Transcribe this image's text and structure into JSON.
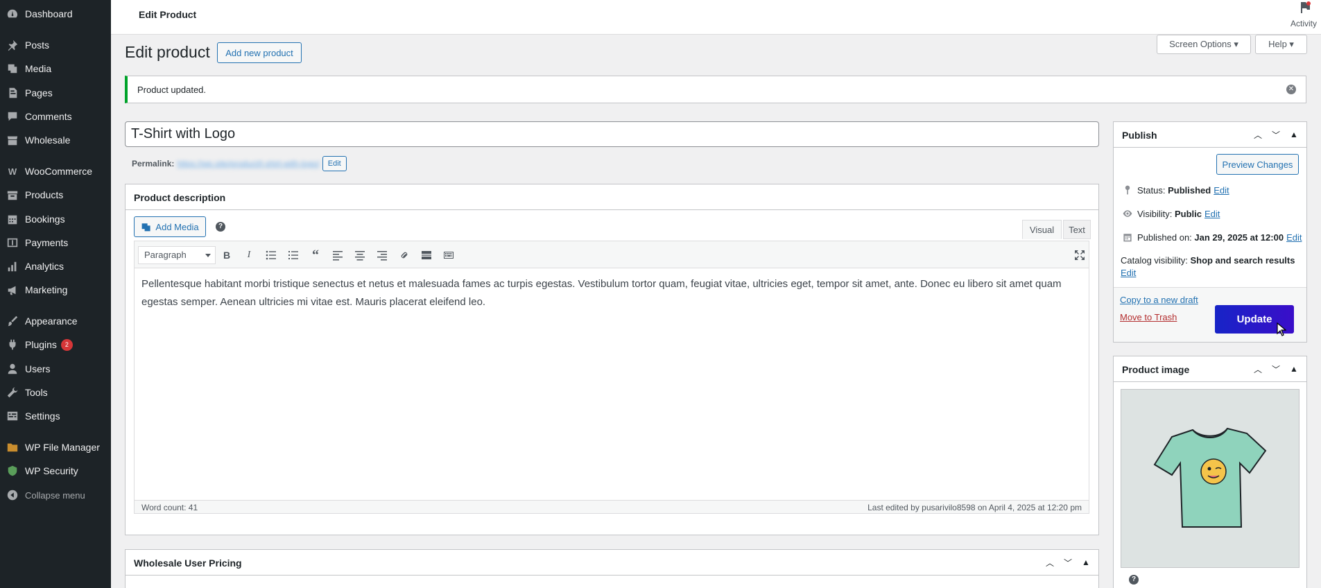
{
  "sidebar": {
    "items": [
      {
        "label": "Dashboard",
        "icon": "dashboard-icon"
      },
      {
        "label": "Posts",
        "icon": "pin-icon"
      },
      {
        "label": "Media",
        "icon": "media-icon"
      },
      {
        "label": "Pages",
        "icon": "pages-icon"
      },
      {
        "label": "Comments",
        "icon": "comment-icon"
      },
      {
        "label": "Wholesale",
        "icon": "store-icon"
      },
      {
        "label": "WooCommerce",
        "icon": "woo-icon"
      },
      {
        "label": "Products",
        "icon": "archive-icon"
      },
      {
        "label": "Bookings",
        "icon": "calendar-icon"
      },
      {
        "label": "Payments",
        "icon": "dollar-icon"
      },
      {
        "label": "Analytics",
        "icon": "chart-icon"
      },
      {
        "label": "Marketing",
        "icon": "megaphone-icon"
      },
      {
        "label": "Appearance",
        "icon": "brush-icon"
      },
      {
        "label": "Plugins",
        "icon": "plugin-icon",
        "badge": "2"
      },
      {
        "label": "Users",
        "icon": "user-icon"
      },
      {
        "label": "Tools",
        "icon": "wrench-icon"
      },
      {
        "label": "Settings",
        "icon": "settings-icon"
      },
      {
        "label": "WP File Manager",
        "icon": "folder-icon"
      },
      {
        "label": "WP Security",
        "icon": "shield-icon"
      }
    ],
    "collapse_label": "Collapse menu"
  },
  "topbar": {
    "page_label": "Edit Product",
    "activity_label": "Activity"
  },
  "header": {
    "title": "Edit product",
    "add_new_label": "Add new product",
    "screen_options_label": "Screen Options ▾",
    "help_label": "Help ▾"
  },
  "notice": {
    "text": "Product updated."
  },
  "product": {
    "title": "T-Shirt with Logo",
    "permalink_label": "Permalink:",
    "permalink_url": "https://wp.site/product/t-shirt-with-logo/",
    "permalink_edit": "Edit"
  },
  "description_panel": {
    "title": "Product description",
    "add_media_label": "Add Media",
    "tab_visual": "Visual",
    "tab_text": "Text",
    "format_value": "Paragraph",
    "content": "Pellentesque habitant morbi tristique senectus et netus et malesuada fames ac turpis egestas. Vestibulum tortor quam, feugiat vitae, ultricies eget, tempor sit amet, ante. Donec eu libero sit amet quam egestas semper. Aenean ultricies mi vitae est. Mauris placerat eleifend leo.",
    "word_count": "Word count: 41",
    "last_edited": "Last edited by pusarivilo8598 on April 4, 2025 at 12:20 pm"
  },
  "publish": {
    "title": "Publish",
    "preview_label": "Preview Changes",
    "status_label": "Status:",
    "status_value": "Published",
    "visibility_label": "Visibility:",
    "visibility_value": "Public",
    "published_label": "Published on:",
    "published_value": "Jan 29, 2025 at 12:00",
    "catalog_label": "Catalog visibility:",
    "catalog_value": "Shop and search results",
    "edit_label": "Edit",
    "copy_draft": "Copy to a new draft",
    "trash": "Move to Trash",
    "update_label": "Update"
  },
  "product_image": {
    "title": "Product image"
  },
  "wholesale_panel": {
    "title": "Wholesale User Pricing"
  }
}
